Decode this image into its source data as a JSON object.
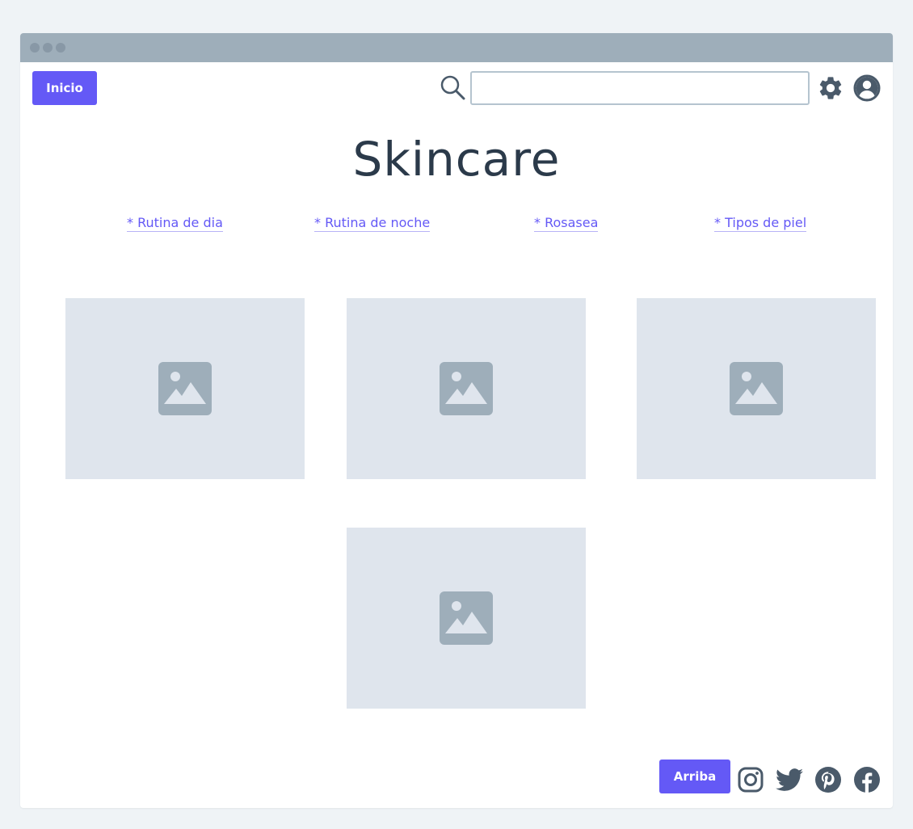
{
  "header": {
    "home_label": "Inicio",
    "search": {
      "value": "",
      "placeholder": ""
    }
  },
  "page": {
    "title": "Skincare",
    "nav_links": [
      "* Rutina de dia",
      "* Rutina de noche",
      "* Rosasea",
      "* Tipos de piel"
    ],
    "images": [
      "image-placeholder",
      "image-placeholder",
      "image-placeholder",
      "image-placeholder"
    ]
  },
  "footer": {
    "top_label": "Arriba",
    "social_icons": [
      "instagram-icon",
      "twitter-icon",
      "pinterest-icon",
      "facebook-icon"
    ]
  },
  "colors": {
    "accent": "#6459f6",
    "icon": "#4a5a6a",
    "placeholder_bg": "#dfe5ed",
    "placeholder_icon": "#9eaeba",
    "titlebar": "#9eaeba"
  }
}
